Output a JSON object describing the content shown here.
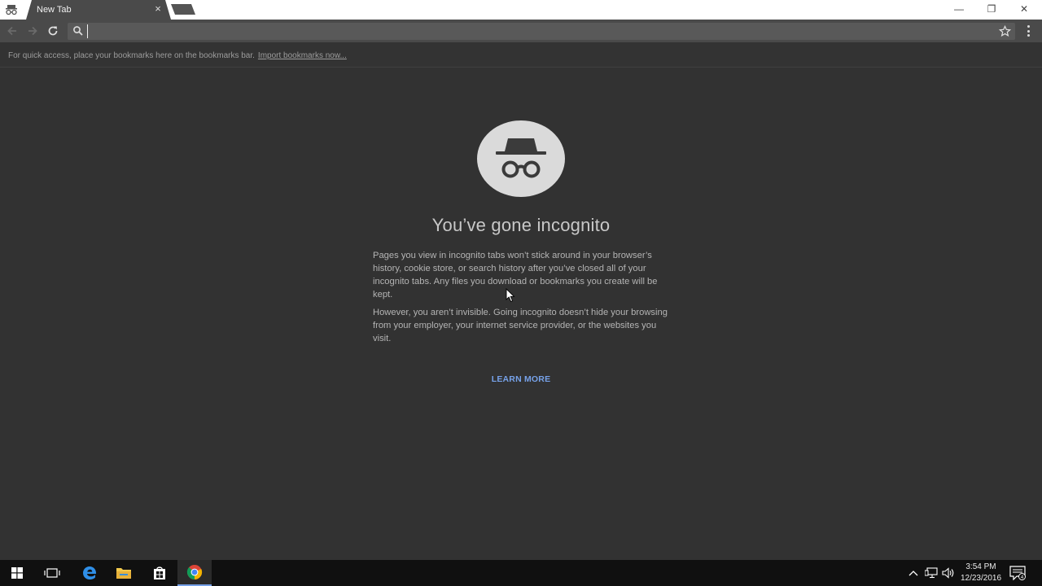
{
  "tab": {
    "title": "New Tab",
    "close": "×"
  },
  "window_controls": {
    "minimize": "—",
    "maximize": "❐",
    "close": "✕"
  },
  "omnibox": {
    "value": "",
    "placeholder": ""
  },
  "bookmarks_bar": {
    "message": "For quick access, place your bookmarks here on the bookmarks bar.",
    "import_link": "Import bookmarks now..."
  },
  "page": {
    "heading": "You’ve gone incognito",
    "paragraph1": "Pages you view in incognito tabs won’t stick around in your browser’s history, cookie store, or search history after you’ve closed all of your incognito tabs. Any files you download or bookmarks you create will be kept.",
    "paragraph2": "However, you aren’t invisible. Going incognito doesn’t hide your browsing from your employer, your internet service provider, or the websites you visit.",
    "learn_more": "LEARN MORE"
  },
  "taskbar": {
    "icons": [
      "windows-start-icon",
      "task-view-icon",
      "edge-icon",
      "file-explorer-icon",
      "store-icon",
      "chrome-icon"
    ],
    "time": "3:54 PM",
    "date": "12/23/2016",
    "notification_count": "4"
  },
  "colors": {
    "background": "#323232",
    "toolbar": "#4a4a4a",
    "accent": "#76a1e8"
  }
}
